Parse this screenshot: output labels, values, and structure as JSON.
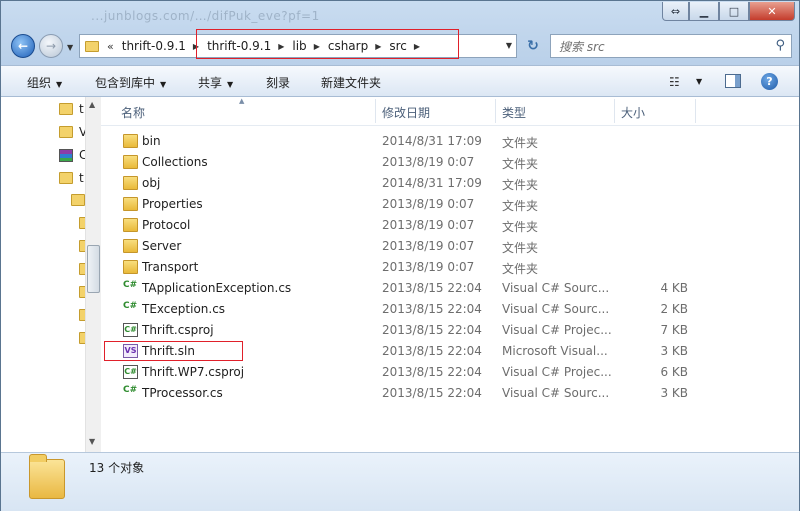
{
  "window": {
    "ghost_title": "...junblogs.com/…/difPuk_eve?pf=1"
  },
  "address": {
    "breadcrumbs": [
      "thrift-0.9.1",
      "thrift-0.9.1",
      "lib",
      "csharp",
      "src"
    ],
    "search_placeholder": "搜索 src"
  },
  "toolbar": {
    "organize": "组织",
    "include_in_library": "包含到库中",
    "share": "共享",
    "burn": "刻录",
    "new_folder": "新建文件夹"
  },
  "navpane": {
    "items": [
      {
        "label": "t",
        "icon": "folder"
      },
      {
        "label": "V",
        "icon": "folder"
      },
      {
        "label": "C",
        "icon": "archive"
      },
      {
        "label": "t",
        "icon": "folder"
      }
    ]
  },
  "columns": {
    "name": "名称",
    "date": "修改日期",
    "type": "类型",
    "size": "大小"
  },
  "files": [
    {
      "name": "bin",
      "date": "2014/8/31 17:09",
      "type": "文件夹",
      "size": "",
      "icon": "folder"
    },
    {
      "name": "Collections",
      "date": "2013/8/19 0:07",
      "type": "文件夹",
      "size": "",
      "icon": "folder"
    },
    {
      "name": "obj",
      "date": "2014/8/31 17:09",
      "type": "文件夹",
      "size": "",
      "icon": "folder"
    },
    {
      "name": "Properties",
      "date": "2013/8/19 0:07",
      "type": "文件夹",
      "size": "",
      "icon": "folder"
    },
    {
      "name": "Protocol",
      "date": "2013/8/19 0:07",
      "type": "文件夹",
      "size": "",
      "icon": "folder"
    },
    {
      "name": "Server",
      "date": "2013/8/19 0:07",
      "type": "文件夹",
      "size": "",
      "icon": "folder"
    },
    {
      "name": "Transport",
      "date": "2013/8/19 0:07",
      "type": "文件夹",
      "size": "",
      "icon": "folder"
    },
    {
      "name": "TApplicationException.cs",
      "date": "2013/8/15 22:04",
      "type": "Visual C# Sourc...",
      "size": "4 KB",
      "icon": "cs"
    },
    {
      "name": "TException.cs",
      "date": "2013/8/15 22:04",
      "type": "Visual C# Sourc...",
      "size": "2 KB",
      "icon": "cs"
    },
    {
      "name": "Thrift.csproj",
      "date": "2013/8/15 22:04",
      "type": "Visual C# Projec...",
      "size": "7 KB",
      "icon": "csproj"
    },
    {
      "name": "Thrift.sln",
      "date": "2013/8/15 22:04",
      "type": "Microsoft Visual...",
      "size": "3 KB",
      "icon": "sln"
    },
    {
      "name": "Thrift.WP7.csproj",
      "date": "2013/8/15 22:04",
      "type": "Visual C# Projec...",
      "size": "6 KB",
      "icon": "csproj"
    },
    {
      "name": "TProcessor.cs",
      "date": "2013/8/15 22:04",
      "type": "Visual C# Sourc...",
      "size": "3 KB",
      "icon": "cs"
    }
  ],
  "status": {
    "item_count": "13 个对象"
  },
  "colors": {
    "highlight_box": "#e0202a",
    "window_frame": "#b9d1ea"
  }
}
